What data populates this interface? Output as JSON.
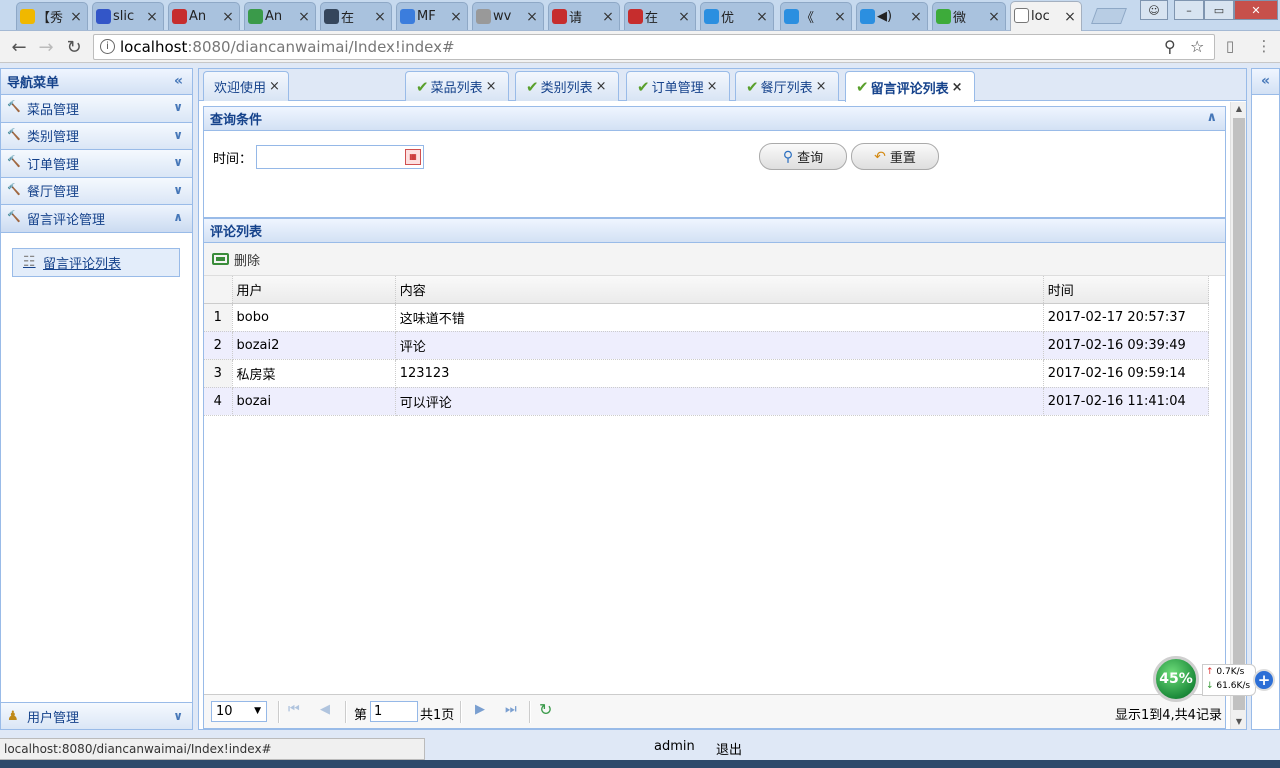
{
  "browser": {
    "tabs": [
      {
        "label": "【秀",
        "icon": "weather-icon",
        "color": "#f0b800"
      },
      {
        "label": "slic",
        "icon": "paw-icon",
        "color": "#3356c8"
      },
      {
        "label": "An",
        "icon": "csdn-icon",
        "color": "#c62d2d"
      },
      {
        "label": "An",
        "icon": "refresh-green-icon",
        "color": "#3a9a4a"
      },
      {
        "label": "在",
        "icon": "tumblr-icon",
        "color": "#35465c"
      },
      {
        "label": "MF",
        "icon": "google-icon",
        "color": "#3b7ddd"
      },
      {
        "label": "wv",
        "icon": "paw-icon",
        "color": "#999999"
      },
      {
        "label": "请",
        "icon": "csdn-icon",
        "color": "#c62d2d"
      },
      {
        "label": "在",
        "icon": "csdn-icon",
        "color": "#c62d2d"
      },
      {
        "label": "优",
        "icon": "play-icon",
        "color": "#2b8fe0"
      },
      {
        "label": "《",
        "icon": "play-icon",
        "color": "#2b8fe0"
      },
      {
        "label": "◀)",
        "icon": "play-icon",
        "color": "#2b8fe0"
      },
      {
        "label": "微",
        "icon": "wechat-icon",
        "color": "#3dab3a"
      },
      {
        "label": "loc",
        "icon": "page-icon",
        "color": "#ffffff"
      }
    ],
    "url_host": "localhost",
    "url_path": ":8080/diancanwaimai/Index!index#",
    "status_url": "localhost:8080/diancanwaimai/Index!index#"
  },
  "nav": {
    "title": "导航菜单",
    "items": [
      {
        "label": "菜品管理"
      },
      {
        "label": "类别管理"
      },
      {
        "label": "订单管理"
      },
      {
        "label": "餐厅管理"
      },
      {
        "label": "留言评论管理"
      }
    ],
    "sub_item": "留言评论列表",
    "bottom_item": "用户管理"
  },
  "main_tabs": [
    {
      "label": "欢迎使用",
      "checked": false
    },
    {
      "label": "菜品列表",
      "checked": true
    },
    {
      "label": "类别列表",
      "checked": true
    },
    {
      "label": "订单管理",
      "checked": true
    },
    {
      "label": "餐厅列表",
      "checked": true
    },
    {
      "label": "留言评论列表",
      "checked": true
    }
  ],
  "query": {
    "title": "查询条件",
    "time_label": "时间：",
    "time_value": "",
    "search_label": "查询",
    "reset_label": "重置"
  },
  "comments": {
    "title": "评论列表",
    "delete_label": "删除",
    "columns": [
      "用户",
      "内容",
      "时间"
    ],
    "rows": [
      {
        "n": "1",
        "user": "bobo",
        "content": "这味道不错",
        "time": "2017-02-17 20:57:37"
      },
      {
        "n": "2",
        "user": "bozai2",
        "content": "评论",
        "time": "2017-02-16 09:39:49"
      },
      {
        "n": "3",
        "user": "私房菜",
        "content": "123123",
        "time": "2017-02-16 09:59:14"
      },
      {
        "n": "4",
        "user": "bozai",
        "content": "可以评论",
        "time": "2017-02-16 11:41:04"
      }
    ]
  },
  "pager": {
    "page_size": "10",
    "page_prefix": "第",
    "page_number": "1",
    "total_pages": "共1页",
    "summary": "显示1到4,共4记录"
  },
  "footer": {
    "user": "admin",
    "logout": "退出"
  },
  "net_widget": {
    "percent": "45%",
    "up_rate": "0.7K/s",
    "down_rate": "61.6K/s"
  },
  "colors": {
    "accent": "#15428b",
    "border": "#99bbe8",
    "alt_row": "#eeeefd"
  }
}
